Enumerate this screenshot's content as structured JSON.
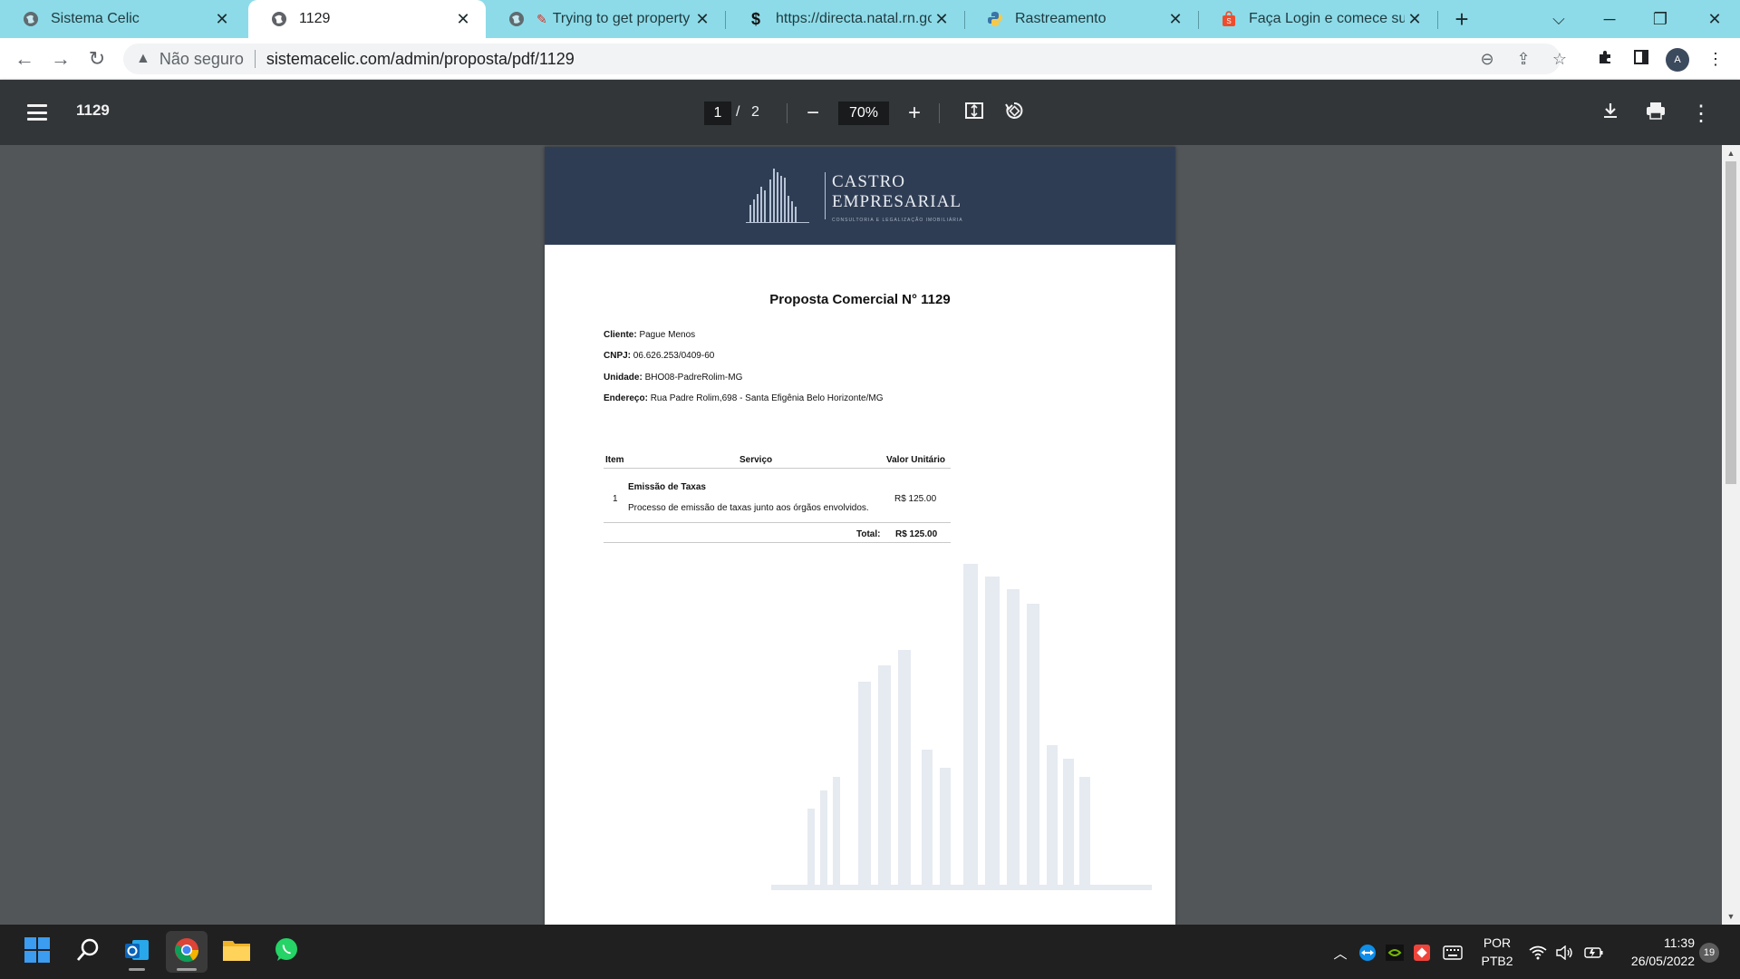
{
  "tabs": [
    {
      "title": "Sistema Celic",
      "favicon": "globe-icon"
    },
    {
      "title": "1129",
      "favicon": "globe-icon"
    },
    {
      "title": "Trying to get property 'r",
      "favicon": "globe-icon"
    },
    {
      "title": "https://directa.natal.rn.gov.b",
      "favicon": "dollar-icon"
    },
    {
      "title": "Rastreamento",
      "favicon": "python-icon"
    },
    {
      "title": "Faça Login e comece suas C",
      "favicon": "shopping-bag-icon"
    }
  ],
  "address_bar": {
    "security_label": "Não seguro",
    "url": "sistemacelic.com/admin/proposta/pdf/1129"
  },
  "pdf_toolbar": {
    "title": "1129",
    "current_page": "1",
    "page_separator": "/",
    "total_pages": "2",
    "zoom": "70%"
  },
  "document": {
    "logo": {
      "line1": "CASTRO",
      "line2": "EMPRESARIAL",
      "tagline": "CONSULTORIA E LEGALIZAÇÃO IMOBILIÁRIA"
    },
    "title": "Proposta Comercial N° 1129",
    "fields": [
      {
        "label": "Cliente:",
        "value": "Pague Menos"
      },
      {
        "label": "CNPJ:",
        "value": "06.626.253/0409-60"
      },
      {
        "label": "Unidade:",
        "value": "BHO08-PadreRolim-MG"
      },
      {
        "label": "Endereço:",
        "value": "Rua Padre Rolim,698 - Santa Efigênia Belo Horizonte/MG"
      }
    ],
    "table": {
      "headers": [
        "Item",
        "Serviço",
        "Valor Unitário"
      ],
      "rows": [
        {
          "item": "1",
          "service_title": "Emissão de Taxas",
          "service_desc": "Processo de emissão de taxas junto aos órgãos envolvidos.",
          "value": "R$ 125.00"
        }
      ],
      "total_label": "Total:",
      "total_value": "R$ 125.00"
    }
  },
  "taskbar": {
    "apps": [
      "start-icon",
      "search-icon",
      "outlook-icon",
      "chrome-icon",
      "file-explorer-icon",
      "whatsapp-icon"
    ],
    "language": {
      "line1": "POR",
      "line2": "PTB2"
    },
    "clock": {
      "time": "11:39",
      "date": "26/05/2022"
    },
    "notifications": "19"
  },
  "colors": {
    "tabstrip": "#8ddbe8",
    "pdf_toolbar": "#323639",
    "viewer_bg": "#525659",
    "doc_header": "#2f3d54"
  }
}
